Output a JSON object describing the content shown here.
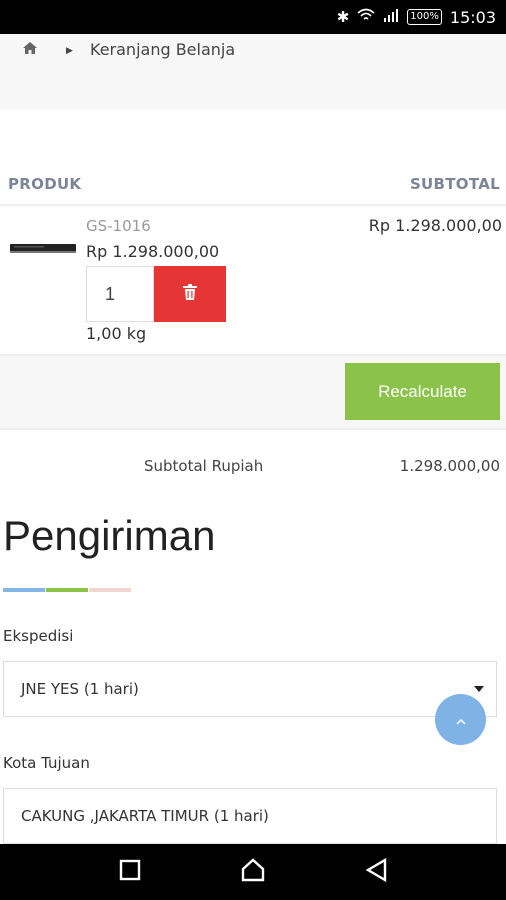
{
  "status_bar": {
    "time": "15:03",
    "battery": "100%",
    "icons": [
      "bluetooth-icon",
      "wifi-icon",
      "signal-icon"
    ]
  },
  "breadcrumb": {
    "home_icon": "home-icon",
    "current": "Keranjang Belanja"
  },
  "table": {
    "headers": {
      "product": "PRODUK",
      "subtotal": "SUBTOTAL"
    },
    "items": [
      {
        "sku": "GS-1016",
        "price": "Rp 1.298.000,00",
        "quantity": "1",
        "weight": "1,00 kg",
        "subtotal": "Rp 1.298.000,00"
      }
    ]
  },
  "recalculate_label": "Recalculate",
  "summary": {
    "label": "Subtotal Rupiah",
    "value": "1.298.000,00"
  },
  "shipping": {
    "heading": "Pengiriman",
    "stripe_colors": [
      "#82b6e6",
      "#8bc34a",
      "#f0d6cf"
    ],
    "courier_label": "Ekspedisi",
    "courier_value": "JNE YES (1 hari)",
    "city_label": "Kota Tujuan",
    "city_value": "CAKUNG ,JAKARTA TIMUR (1 hari)"
  },
  "colors": {
    "delete": "#e53535",
    "recalculate": "#8bc34a",
    "scroll_top": "#7fb2e5"
  }
}
